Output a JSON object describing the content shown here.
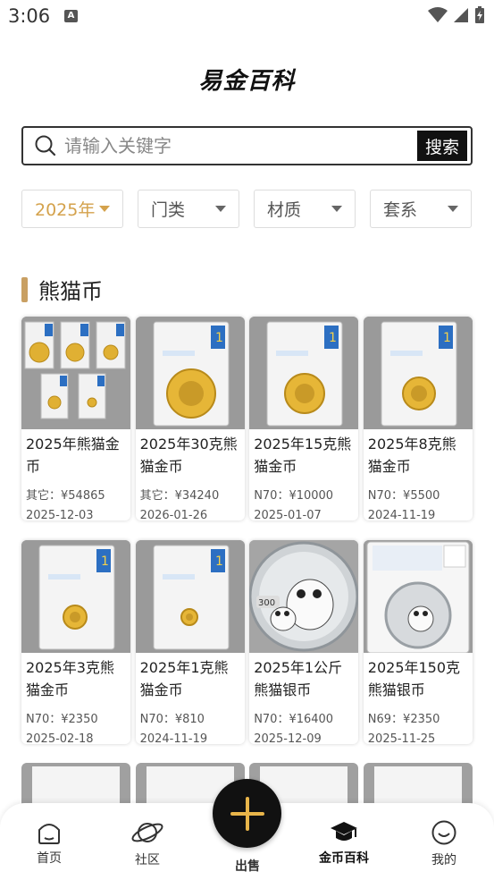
{
  "status": {
    "time": "3:06",
    "notification_letter": "A"
  },
  "app": {
    "title": "易金百科"
  },
  "search": {
    "placeholder": "请输入关键字",
    "button_label": "搜索"
  },
  "filters": [
    {
      "label": "2025年",
      "active": true
    },
    {
      "label": "门类",
      "active": false
    },
    {
      "label": "材质",
      "active": false
    },
    {
      "label": "套系",
      "active": false
    }
  ],
  "section": {
    "title": "熊猫币"
  },
  "cards": [
    {
      "title": "2025年熊猫金币",
      "price": "其它：¥54865",
      "date": "2025-12-03",
      "image": "gold-set"
    },
    {
      "title": "2025年30克熊猫金币",
      "price": "其它：¥34240",
      "date": "2026-01-26",
      "image": "gold-slab"
    },
    {
      "title": "2025年15克熊猫金币",
      "price": "N70：¥10000",
      "date": "2025-01-07",
      "image": "gold-slab"
    },
    {
      "title": "2025年8克熊猫金币",
      "price": "N70：¥5500",
      "date": "2024-11-19",
      "image": "gold-slab"
    },
    {
      "title": "2025年3克熊猫金币",
      "price": "N70：¥2350",
      "date": "2025-02-18",
      "image": "gold-slab-small"
    },
    {
      "title": "2025年1克熊猫金币",
      "price": "N70：¥810",
      "date": "2024-11-19",
      "image": "gold-slab-small"
    },
    {
      "title": "2025年1公斤熊猫银币",
      "price": "N70：¥16400",
      "date": "2025-12-09",
      "image": "silver-large"
    },
    {
      "title": "2025年150克熊猫银币",
      "price": "N69：¥2350",
      "date": "2025-11-25",
      "image": "silver-slab"
    }
  ],
  "tabs": [
    {
      "label": "首页",
      "icon": "home-icon"
    },
    {
      "label": "社区",
      "icon": "planet-icon"
    },
    {
      "label": "出售",
      "icon": "plus-icon"
    },
    {
      "label": "金币百科",
      "icon": "graduation-cap-icon"
    },
    {
      "label": "我的",
      "icon": "smile-icon"
    }
  ],
  "colors": {
    "accent": "#d4a24c",
    "section_bar": "#c9a063",
    "dark": "#111111"
  }
}
